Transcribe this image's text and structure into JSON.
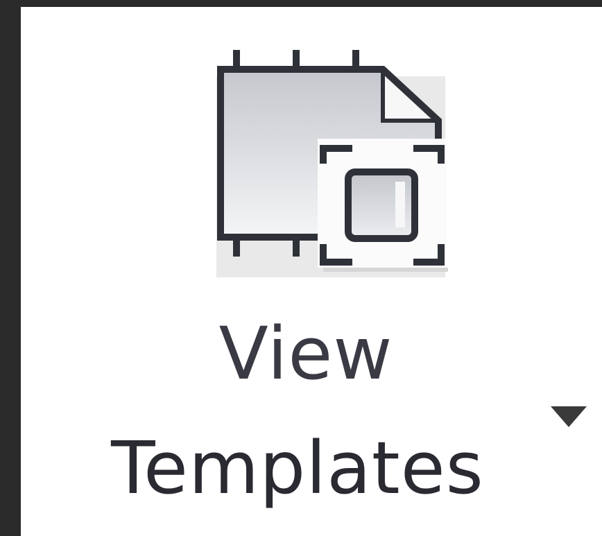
{
  "button": {
    "label_line1": "View",
    "label_line2": "Templates"
  },
  "icons": {
    "main": "view-template-icon",
    "dropdown": "dropdown-arrow-icon"
  },
  "colors": {
    "background": "#2b2b2b",
    "button_background": "#ffffff",
    "icon_outline": "#2e3138",
    "label_text": "#2a2a32"
  }
}
